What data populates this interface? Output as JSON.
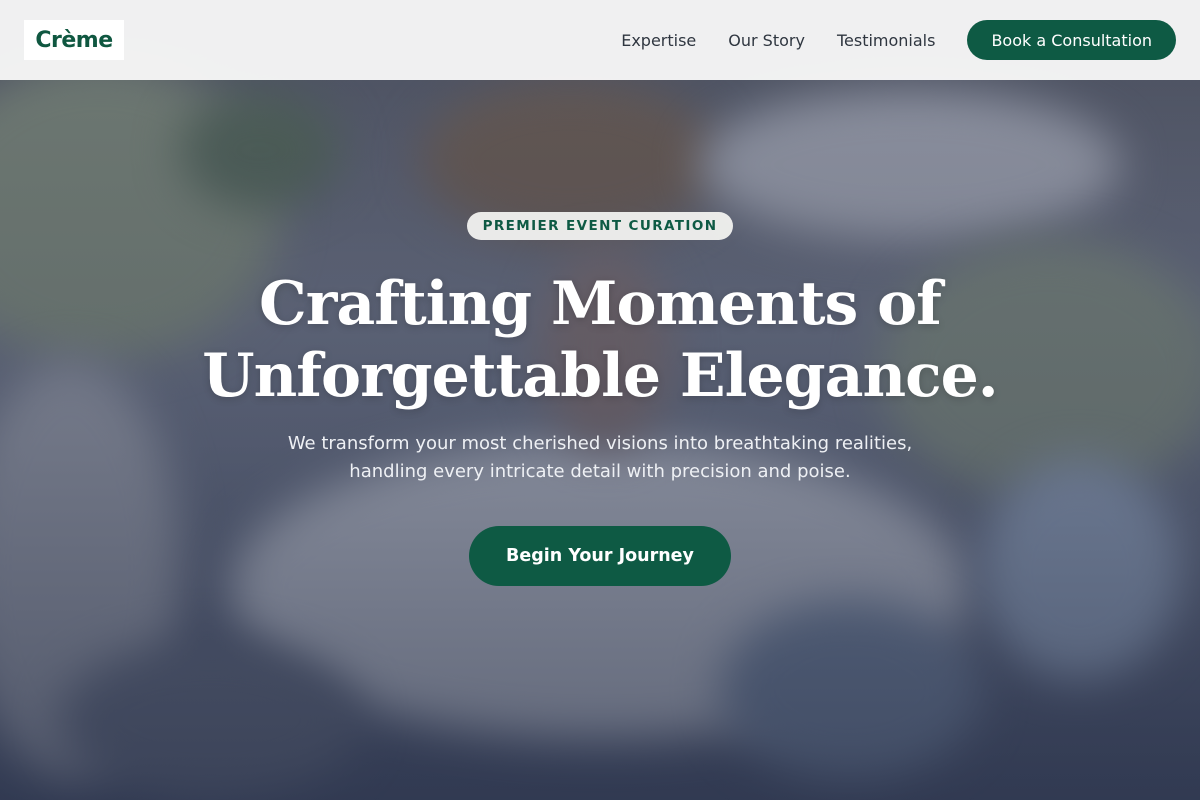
{
  "brand": {
    "logo_text": "Crème"
  },
  "nav": {
    "links": [
      "Expertise",
      "Our Story",
      "Testimonials"
    ],
    "cta_label": "Book a Consultation"
  },
  "hero": {
    "eyebrow": "PREMIER EVENT CURATION",
    "headline_line1": "Crafting Moments of",
    "headline_line2": "Unforgettable Elegance.",
    "subtext": "We transform your most cherished visions into breathtaking realities, handling every intricate detail with precision and poise.",
    "cta_label": "Begin Your Journey"
  },
  "colors": {
    "brand_green": "#0e5a44",
    "navbar_bg": "#f6f6f6",
    "hero_overlay": "#242c44"
  }
}
